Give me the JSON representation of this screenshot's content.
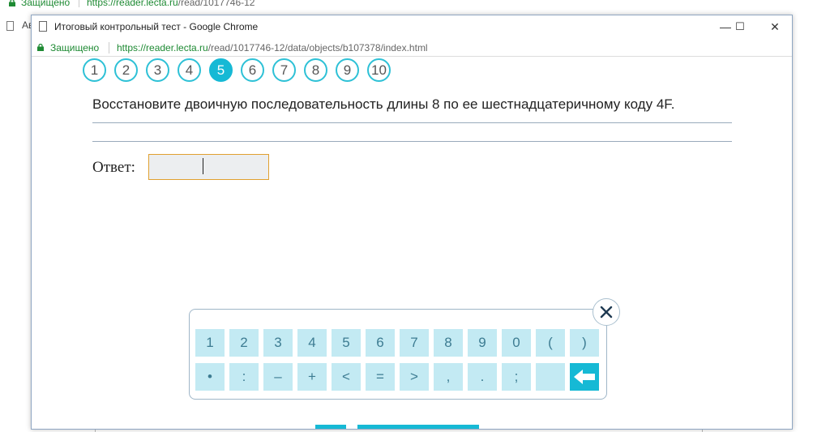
{
  "background": {
    "secure_label": "Защищено",
    "url_host": "https://reader.lecta.ru",
    "url_path": "/read/1017746-12",
    "bookmark_label": "Ав"
  },
  "window": {
    "title": "Итоговый контрольный тест - Google Chrome",
    "controls": {
      "minimize": "—",
      "maximize": "☐",
      "close": "✕"
    },
    "secure_label": "Защищено",
    "url_host": "https://reader.lecta.ru",
    "url_path": "/read/1017746-12/data/objects/b107378/index.html"
  },
  "question_nav": {
    "items": [
      "1",
      "2",
      "3",
      "4",
      "5",
      "6",
      "7",
      "8",
      "9",
      "10"
    ],
    "active_index": 4
  },
  "question": {
    "text": "Восстановите двоичную последовательность длины 8 по ее шестнадцатеричному коду 4F.",
    "answer_label": "Ответ:",
    "answer_value": ""
  },
  "keypad": {
    "row1": [
      "1",
      "2",
      "3",
      "4",
      "5",
      "6",
      "7",
      "8",
      "9",
      "0",
      "(",
      ")"
    ],
    "row2": [
      "•",
      ":",
      "–",
      "+",
      "<",
      "=",
      ">",
      ",",
      ".",
      ";",
      ""
    ]
  },
  "colors": {
    "accent": "#16b9d5",
    "key_bg": "#c3eaf3",
    "input_border": "#e0a030",
    "secure_green": "#1e8a33"
  }
}
